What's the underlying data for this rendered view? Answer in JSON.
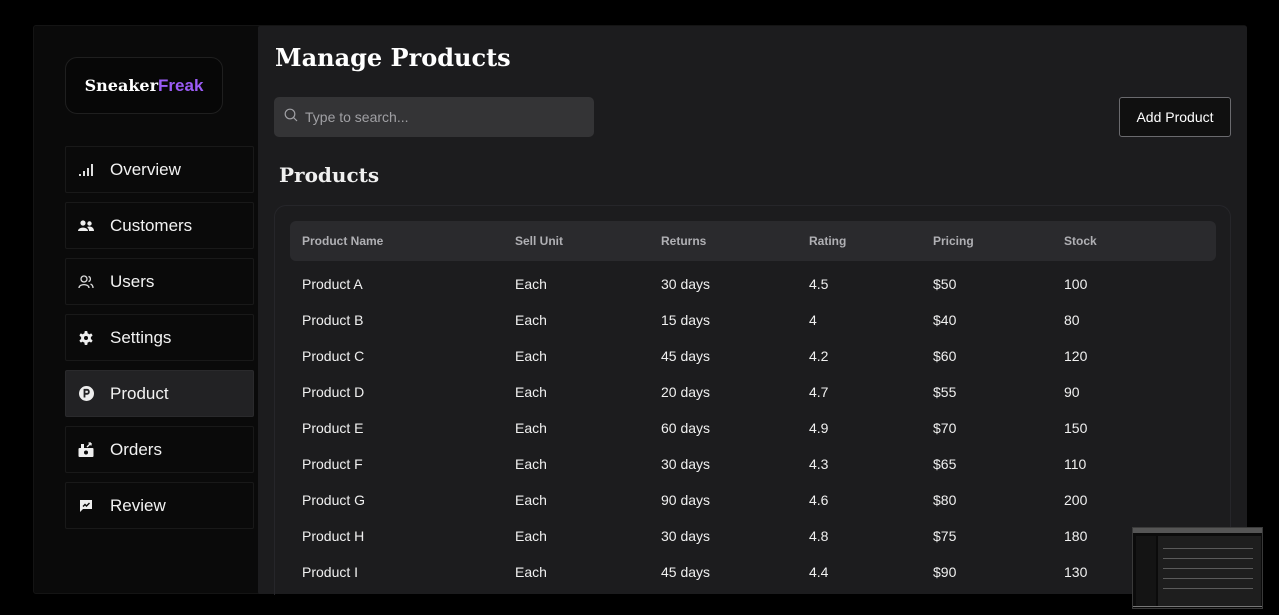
{
  "brand": {
    "part1": "Sneaker",
    "part2": "Freak",
    "accent_color": "#9b5cf6"
  },
  "sidebar": {
    "items": [
      {
        "label": "Overview",
        "icon": "signal-bars-icon",
        "active": false
      },
      {
        "label": "Customers",
        "icon": "people-icon",
        "active": false
      },
      {
        "label": "Users",
        "icon": "users-outline-icon",
        "active": false
      },
      {
        "label": "Settings",
        "icon": "gear-icon",
        "active": false
      },
      {
        "label": "Product",
        "icon": "product-p-icon",
        "active": true
      },
      {
        "label": "Orders",
        "icon": "orders-icon",
        "active": false
      },
      {
        "label": "Review",
        "icon": "review-icon",
        "active": false
      }
    ]
  },
  "main": {
    "title": "Manage Products",
    "search": {
      "placeholder": "Type to search...",
      "value": "",
      "icon": "search-icon"
    },
    "add_button_label": "Add Product",
    "section_title": "Products"
  },
  "table": {
    "columns": [
      "Product Name",
      "Sell Unit",
      "Returns",
      "Rating",
      "Pricing",
      "Stock"
    ],
    "rows": [
      [
        "Product A",
        "Each",
        "30 days",
        "4.5",
        "$50",
        "100"
      ],
      [
        "Product B",
        "Each",
        "15 days",
        "4",
        "$40",
        "80"
      ],
      [
        "Product C",
        "Each",
        "45 days",
        "4.2",
        "$60",
        "120"
      ],
      [
        "Product D",
        "Each",
        "20 days",
        "4.7",
        "$55",
        "90"
      ],
      [
        "Product E",
        "Each",
        "60 days",
        "4.9",
        "$70",
        "150"
      ],
      [
        "Product F",
        "Each",
        "30 days",
        "4.3",
        "$65",
        "110"
      ],
      [
        "Product G",
        "Each",
        "90 days",
        "4.6",
        "$80",
        "200"
      ],
      [
        "Product H",
        "Each",
        "30 days",
        "4.8",
        "$75",
        "180"
      ],
      [
        "Product I",
        "Each",
        "45 days",
        "4.4",
        "$90",
        "130"
      ]
    ]
  }
}
